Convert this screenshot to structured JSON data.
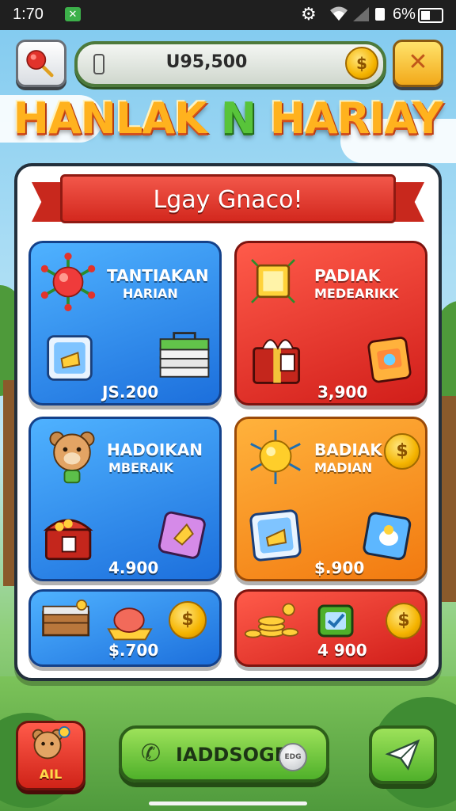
{
  "status_bar": {
    "time": "1:70",
    "app_badge": "✕",
    "battery_text": "6%"
  },
  "top_bar": {
    "balance": "U95,500",
    "coin_symbol": "$",
    "close_symbol": "✕"
  },
  "title": {
    "part1": "HANLAK ",
    "part2": "N",
    "part3": " HARIAY"
  },
  "banner": "Lgay Gnaco!",
  "cards": [
    {
      "name": "TANTIAKAN",
      "sub": "HARIAN",
      "price": "JS.200",
      "color": "blue"
    },
    {
      "name": "PADIAK",
      "sub": "MEDEARIKK",
      "price": "3,900",
      "color": "red"
    },
    {
      "name": "HADOIKAN",
      "sub": "MBERAIK",
      "price": "4.900",
      "color": "blue"
    },
    {
      "name": "BADIAK",
      "sub": "MADIAN",
      "price": "$.900",
      "color": "orange"
    },
    {
      "name": "",
      "sub": "",
      "price": "$.700",
      "color": "blue"
    },
    {
      "name": "",
      "sub": "",
      "price": "4 900",
      "color": "red"
    }
  ],
  "bottom_bar": {
    "mascot_label": "AIL",
    "main_button": "IADDSOGR",
    "main_tag": "EDG"
  },
  "colors": {
    "accent_green": "#4fb02a",
    "card_blue": "#1c6fdc",
    "card_red": "#d11e1a",
    "card_orange": "#f27a10",
    "title_orange": "#ffb21e"
  }
}
